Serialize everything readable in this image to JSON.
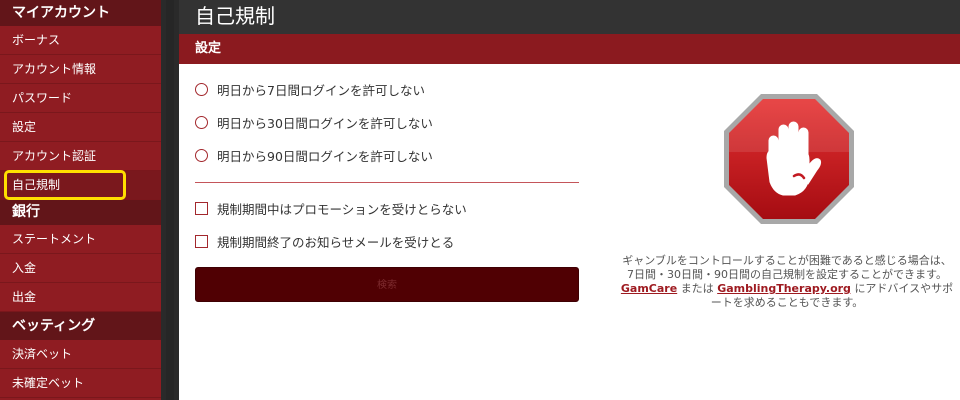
{
  "sidebar": {
    "sections": [
      {
        "heading": "マイアカウント",
        "items": [
          "ボーナス",
          "アカウント情報",
          "パスワード",
          "設定",
          "アカウント認証",
          "自己規制"
        ]
      },
      {
        "heading": "銀行",
        "items": [
          "ステートメント",
          "入金",
          "出金"
        ]
      },
      {
        "heading": "ベッティング",
        "items": [
          "決済ベット",
          "未確定ベット"
        ]
      }
    ],
    "active_item": "自己規制",
    "highlight_color": "#ffe000"
  },
  "header": {
    "title": "自己規制"
  },
  "settings": {
    "title": "設定",
    "radio_options": [
      "明日から7日間ログインを許可しない",
      "明日から30日間ログインを許可しない",
      "明日から90日間ログインを許可しない"
    ],
    "checkboxes": [
      "規制期間中はプロモーションを受けとらない",
      "規制期間終了のお知らせメールを受けとる"
    ],
    "search_button": "検索"
  },
  "info": {
    "text_before": "ギャンブルをコントロールすることが困難であると感じる場合は、 7日間・30日間・90日間の自己規制を設定することができます。",
    "link1": "GamCare",
    "between": "または",
    "link2": "GamblingTherapy.org",
    "text_after": "にアドバイスやサポートを求めることもできます。",
    "icon": "stop-hand-icon"
  },
  "colors": {
    "sidebar_bg": "#8f1c22",
    "sidebar_heading_bg": "#621519",
    "topbar_bg": "#333333",
    "section_bar_bg": "#8b1a1f",
    "accent": "#a3282d",
    "button_bg": "#500003",
    "stop_red": "#c4111a"
  }
}
